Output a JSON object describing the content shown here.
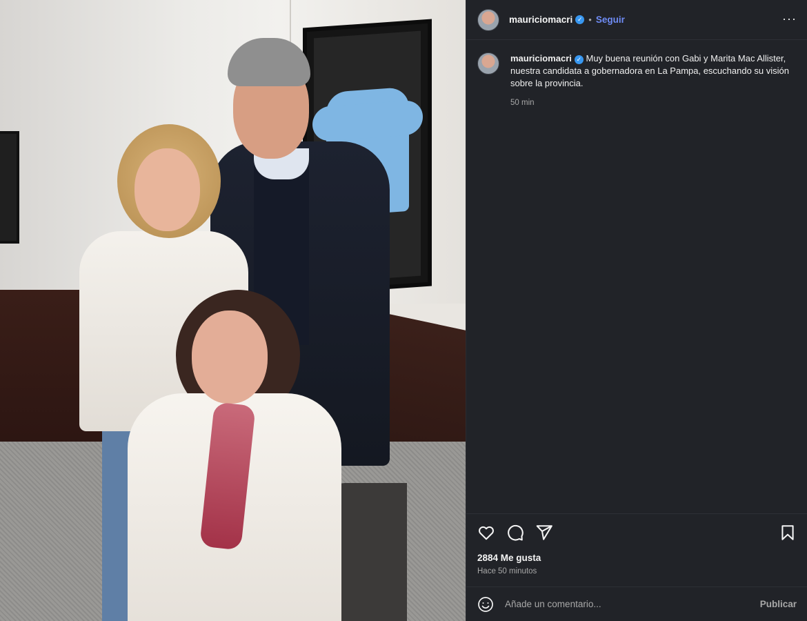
{
  "post": {
    "username": "mauriciomacri",
    "verified_icon": "verified-badge-icon",
    "follow_label": "Seguir",
    "more_icon": "more-options-icon",
    "caption_text": "Muy buena reunión con Gabi y Marita Mac Allister, nuestra candidata a gobernadora en La Pampa, escuchando su visión sobre la provincia.",
    "caption_time": "50 min",
    "likes": "2884 Me gusta",
    "posted_ago": "Hace 50 minutos"
  },
  "actions": {
    "like_icon": "heart-icon",
    "comment_icon": "comment-icon",
    "share_icon": "share-icon",
    "save_icon": "bookmark-icon"
  },
  "comment": {
    "placeholder": "Añade un comentario...",
    "publish_label": "Publicar",
    "emoji_icon": "emoji-icon"
  },
  "colors": {
    "panel_bg": "#212328",
    "follow_blue": "#6f8cf5",
    "verified_blue": "#3897f0"
  }
}
